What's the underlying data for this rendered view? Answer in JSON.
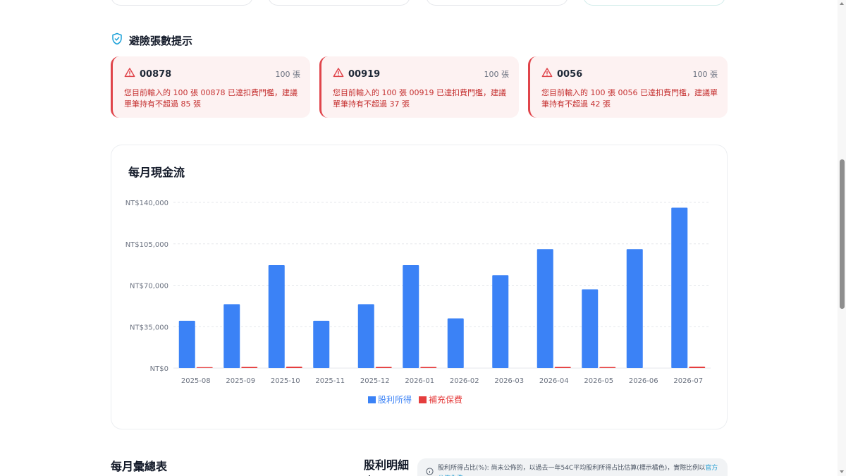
{
  "risk_section": {
    "title": "避險張數提示",
    "icon": "shield-check-icon",
    "accent_color": "#1aa0d8"
  },
  "warnings": [
    {
      "code": "00878",
      "qty": "100 張",
      "message": "您目前輸入的 100 張 00878 已達扣費門檻，建議單筆持有不超過 85 張"
    },
    {
      "code": "00919",
      "qty": "100 張",
      "message": "您目前輸入的 100 張 00919 已達扣費門檻，建議單筆持有不超過 37 張"
    },
    {
      "code": "0056",
      "qty": "100 張",
      "message": "您目前輸入的 100 張 0056 已達扣費門檻，建議單筆持有不超過 42 張"
    }
  ],
  "warning_colors": {
    "border": "#e0454b",
    "text": "#c53030",
    "background": "#fdf2f2"
  },
  "cashflow": {
    "title": "每月現金流"
  },
  "chart_data": {
    "type": "bar",
    "title": "每月現金流",
    "categories": [
      "2025-08",
      "2025-09",
      "2025-10",
      "2025-11",
      "2025-12",
      "2026-01",
      "2026-02",
      "2026-03",
      "2026-04",
      "2026-05",
      "2026-06",
      "2026-07"
    ],
    "series": [
      {
        "name": "股利所得",
        "color": "#3b82f6",
        "values": [
          40000,
          54000,
          87000,
          40000,
          54000,
          87000,
          42000,
          78500,
          100500,
          66500,
          100500,
          135500
        ]
      },
      {
        "name": "補充保費",
        "color": "#e53e3e",
        "values": [
          840,
          1130,
          1230,
          0,
          1130,
          1010,
          0,
          0,
          1080,
          960,
          0,
          1270
        ]
      }
    ],
    "yticks": [
      "NT$0",
      "NT$35,000",
      "NT$70,000",
      "NT$105,000",
      "NT$140,000"
    ],
    "ylim": [
      0,
      140000
    ],
    "grid": true,
    "legend_position": "bottom-center"
  },
  "monthly_summary": {
    "title": "每月彙總表"
  },
  "dividend_detail": {
    "title": "股利明細表",
    "note": "股利所得占比(%): 尚未公佈的，以過去一年54C平均股利所得占比估算(標示橘色)，實際比例以",
    "note_link": "官方公佈為準"
  }
}
